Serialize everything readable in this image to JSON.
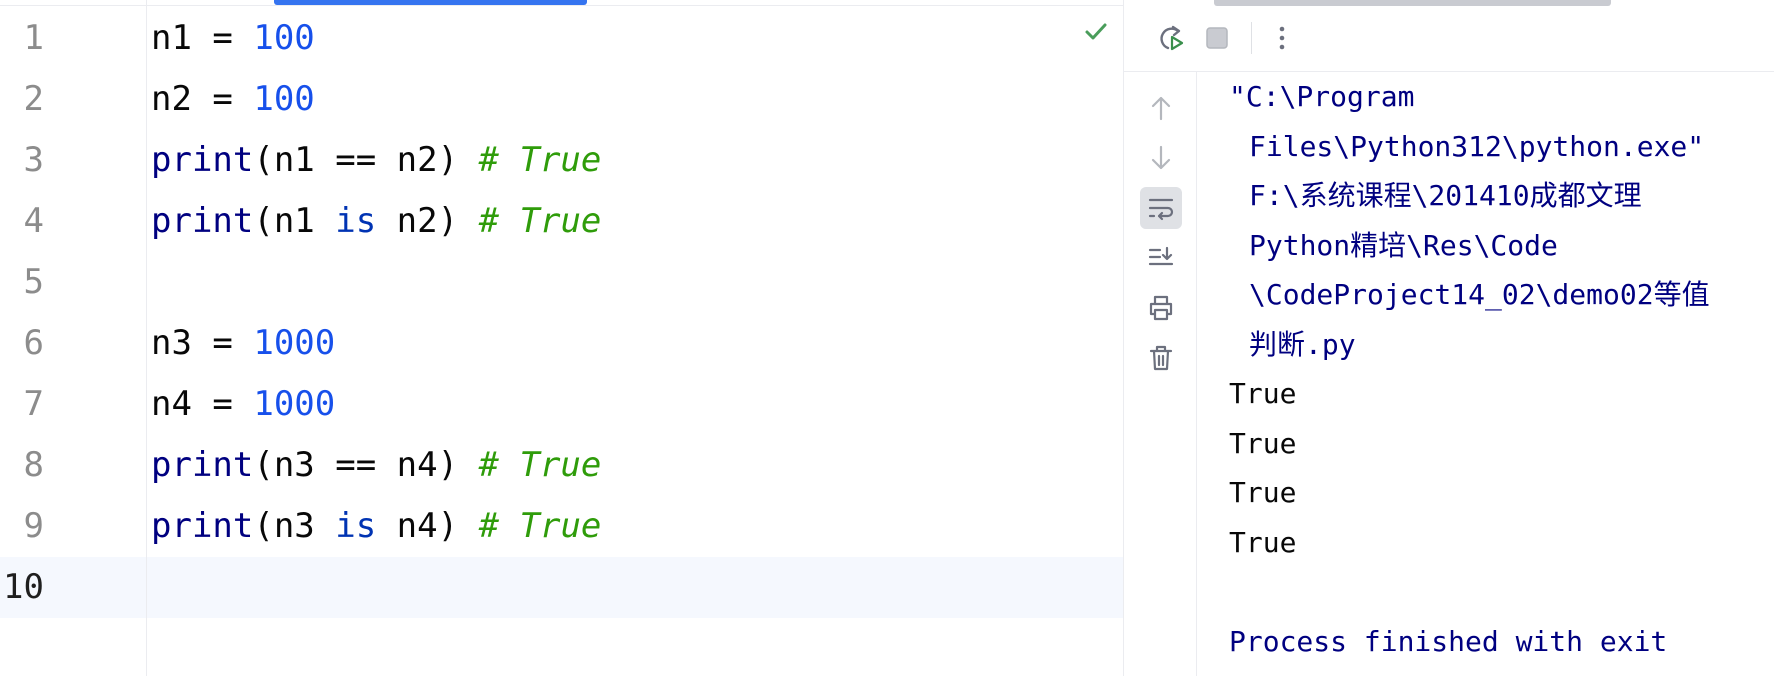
{
  "editor": {
    "line_numbers": [
      "1",
      "2",
      "3",
      "4",
      "5",
      "6",
      "7",
      "8",
      "9",
      "10"
    ],
    "active_line_index": 9,
    "lines": [
      [
        {
          "t": "n1 = ",
          "c": "plain"
        },
        {
          "t": "100",
          "c": "num"
        }
      ],
      [
        {
          "t": "n2 = ",
          "c": "plain"
        },
        {
          "t": "100",
          "c": "num"
        }
      ],
      [
        {
          "t": "print",
          "c": "kw-builtin"
        },
        {
          "t": "(n1 == n2) ",
          "c": "plain"
        },
        {
          "t": "# True",
          "c": "comment"
        }
      ],
      [
        {
          "t": "print",
          "c": "kw-builtin"
        },
        {
          "t": "(n1 ",
          "c": "plain"
        },
        {
          "t": "is",
          "c": "kw"
        },
        {
          "t": " n2) ",
          "c": "plain"
        },
        {
          "t": "# True",
          "c": "comment"
        }
      ],
      [],
      [
        {
          "t": "n3 = ",
          "c": "plain"
        },
        {
          "t": "1000",
          "c": "num"
        }
      ],
      [
        {
          "t": "n4 = ",
          "c": "plain"
        },
        {
          "t": "1000",
          "c": "num"
        }
      ],
      [
        {
          "t": "print",
          "c": "kw-builtin"
        },
        {
          "t": "(n3 == n4) ",
          "c": "plain"
        },
        {
          "t": "# True",
          "c": "comment"
        }
      ],
      [
        {
          "t": "print",
          "c": "kw-builtin"
        },
        {
          "t": "(n3 ",
          "c": "plain"
        },
        {
          "t": "is",
          "c": "kw"
        },
        {
          "t": " n4) ",
          "c": "plain"
        },
        {
          "t": "# True",
          "c": "comment"
        }
      ],
      []
    ],
    "inspection_icon": "checkmark-icon"
  },
  "run_panel": {
    "toolbar_icons": [
      "rerun-icon",
      "stop-icon",
      "more-options-icon"
    ],
    "side_icons": [
      {
        "name": "scroll-up-icon",
        "selected": false
      },
      {
        "name": "scroll-down-icon",
        "selected": false
      },
      {
        "name": "soft-wrap-icon",
        "selected": true
      },
      {
        "name": "scroll-to-end-icon",
        "selected": false
      },
      {
        "name": "print-icon",
        "selected": false
      },
      {
        "name": "clear-all-icon",
        "selected": false
      }
    ],
    "console_lines": [
      {
        "text": "\"C:\\Program",
        "kind": "cmd"
      },
      {
        "text": "Files\\Python312\\python.exe\"",
        "kind": "cmd cont"
      },
      {
        "text": "F:\\系统课程\\201410成都文理",
        "kind": "cmd cont"
      },
      {
        "text": "Python精培\\Res\\Code",
        "kind": "cmd cont"
      },
      {
        "text": "\\CodeProject14_02\\demo02等值",
        "kind": "cmd cont"
      },
      {
        "text": "判断.py",
        "kind": "cmd cont"
      },
      {
        "text": "True",
        "kind": "out"
      },
      {
        "text": "True",
        "kind": "out"
      },
      {
        "text": "True",
        "kind": "out"
      },
      {
        "text": "True",
        "kind": "out"
      },
      {
        "text": "",
        "kind": "out"
      },
      {
        "text": "Process finished with exit",
        "kind": "proc"
      }
    ]
  }
}
